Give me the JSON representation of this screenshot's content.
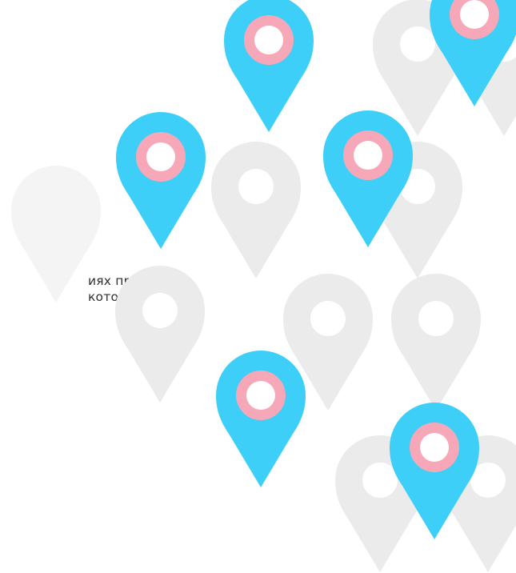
{
  "text_fragment": {
    "line1": "иях при",
    "line2": "которые"
  },
  "colors": {
    "pin_active": "#3dcff8",
    "pin_inactive": "#ebebeb",
    "pin_faint": "#f5f4f4",
    "ring": "#f7a8b8",
    "hole": "#ffffff",
    "text": "#2f2f2f"
  },
  "icons": {
    "pin": "map-marker-icon"
  }
}
